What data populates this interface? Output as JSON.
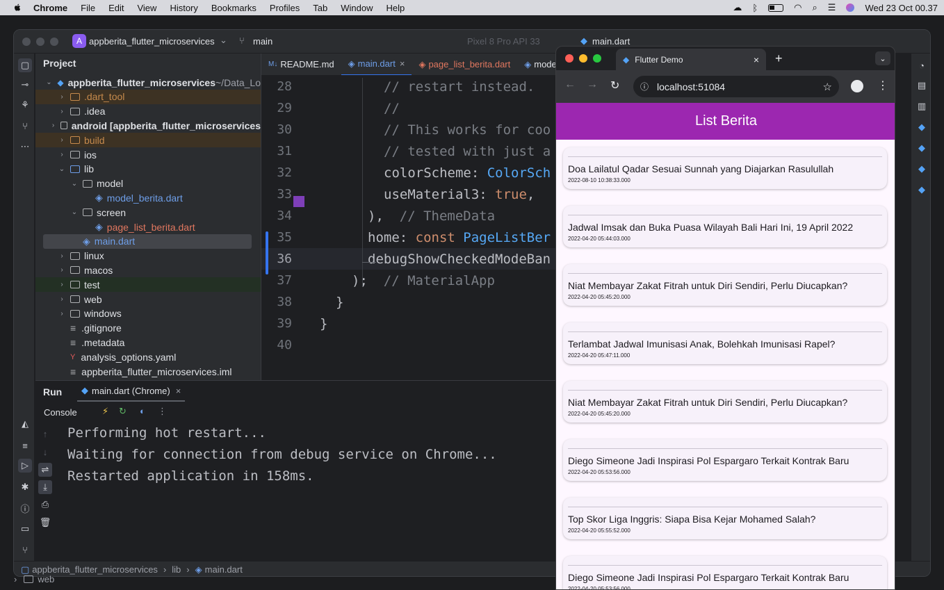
{
  "menubar": {
    "app": "Chrome",
    "items": [
      "File",
      "Edit",
      "View",
      "History",
      "Bookmarks",
      "Profiles",
      "Tab",
      "Window",
      "Help"
    ],
    "datetime": "Wed 23 Oct  00.37"
  },
  "ide": {
    "project_name": "appberita_flutter_microservices",
    "project_badge": "A",
    "branch": "main",
    "device": "Pixel 8 Pro API 33",
    "run_config": "main.dart",
    "target": "Chrome (web)",
    "project_panel_title": "Project",
    "tree": [
      {
        "label": "appberita_flutter_microservices",
        "suffix": "~/Data_Lo",
        "indent": 0,
        "type": "root",
        "chev": "⌄"
      },
      {
        "label": ".dart_tool",
        "indent": 1,
        "type": "folder-orange",
        "chev": "›",
        "color": "#c68a4c",
        "hl": "#3d3223"
      },
      {
        "label": ".idea",
        "indent": 1,
        "type": "folder",
        "chev": "›"
      },
      {
        "label": "android [appberita_flutter_microservices",
        "indent": 1,
        "type": "folder",
        "chev": "›",
        "bold": true
      },
      {
        "label": "build",
        "indent": 1,
        "type": "folder-orange",
        "chev": "›",
        "color": "#c68a4c",
        "hl": "#3d3223"
      },
      {
        "label": "ios",
        "indent": 1,
        "type": "folder",
        "chev": "›"
      },
      {
        "label": "lib",
        "indent": 1,
        "type": "folder-blue",
        "chev": "⌄"
      },
      {
        "label": "model",
        "indent": 2,
        "type": "folder",
        "chev": "⌄"
      },
      {
        "label": "model_berita.dart",
        "indent": 3,
        "type": "dart",
        "color": "#6e9ee8"
      },
      {
        "label": "screen",
        "indent": 2,
        "type": "folder",
        "chev": "⌄"
      },
      {
        "label": "page_list_berita.dart",
        "indent": 3,
        "type": "dart",
        "color": "#e0775f"
      },
      {
        "label": "main.dart",
        "indent": 2,
        "type": "dart",
        "color": "#6e9ee8",
        "hl": "#43454a"
      },
      {
        "label": "linux",
        "indent": 1,
        "type": "folder",
        "chev": "›"
      },
      {
        "label": "macos",
        "indent": 1,
        "type": "folder",
        "chev": "›"
      },
      {
        "label": "test",
        "indent": 1,
        "type": "folder",
        "chev": "›",
        "hl": "#233024"
      },
      {
        "label": "web",
        "indent": 1,
        "type": "folder",
        "chev": "›"
      },
      {
        "label": "windows",
        "indent": 1,
        "type": "folder",
        "chev": "›"
      },
      {
        "label": ".gitignore",
        "indent": 1,
        "type": "file"
      },
      {
        "label": ".metadata",
        "indent": 1,
        "type": "file"
      },
      {
        "label": "analysis_options.yaml",
        "indent": 1,
        "type": "yaml"
      },
      {
        "label": "appberita_flutter_microservices.iml",
        "indent": 1,
        "type": "file"
      }
    ],
    "tabs": [
      {
        "label": "README.md",
        "prefix": "M↓"
      },
      {
        "label": "main.dart",
        "active": true,
        "close": "×"
      },
      {
        "label": "page_list_berita.dart",
        "color": "#e0775f"
      },
      {
        "label": "mode"
      }
    ],
    "code": [
      {
        "n": "28",
        "parts": [
          [
            "cm",
            "// restart instead."
          ]
        ]
      },
      {
        "n": "29",
        "parts": [
          [
            "cm",
            "//"
          ]
        ]
      },
      {
        "n": "30",
        "parts": [
          [
            "cm",
            "// This works for coo"
          ]
        ]
      },
      {
        "n": "31",
        "parts": [
          [
            "cm",
            "// tested with just a"
          ]
        ]
      },
      {
        "n": "32",
        "parts": [
          [
            "",
            "colorScheme: "
          ],
          [
            "cls",
            "ColorSch"
          ]
        ]
      },
      {
        "n": "33",
        "parts": [
          [
            "",
            "useMaterial3: "
          ],
          [
            "kw",
            "true"
          ],
          [
            "",
            ","
          ]
        ]
      },
      {
        "n": "34",
        "parts": [
          [
            "",
            "),  "
          ],
          [
            "cm",
            "// ThemeData"
          ]
        ]
      },
      {
        "n": "35",
        "parts": [
          [
            "",
            "home: "
          ],
          [
            "kw",
            "const "
          ],
          [
            "cls",
            "PageListBer"
          ]
        ]
      },
      {
        "n": "36",
        "parts": [
          [
            "",
            "debugShowCheckedModeBan"
          ]
        ]
      },
      {
        "n": "37",
        "parts": [
          [
            "",
            ");  "
          ],
          [
            "cm",
            "// MaterialApp"
          ]
        ]
      },
      {
        "n": "38",
        "parts": [
          [
            "",
            "}"
          ]
        ]
      },
      {
        "n": "39",
        "parts": [
          [
            "",
            "}"
          ]
        ]
      },
      {
        "n": "40",
        "parts": []
      }
    ],
    "run_tab": "Run",
    "run_config_tab": "main.dart (Chrome)",
    "console_label": "Console",
    "console_lines": [
      "Performing hot restart...",
      "Waiting for connection from debug service on Chrome...",
      "Restarted application in 158ms."
    ],
    "breadcrumb": [
      "appberita_flutter_microservices",
      "lib",
      "main.dart"
    ],
    "bg_tab_hint": "web"
  },
  "browser": {
    "tab_title": "Flutter Demo",
    "url": "localhost:51084",
    "app_title": "List Berita",
    "news": [
      {
        "title": "Doa Lailatul Qadar Sesuai Sunnah yang Diajarkan Rasulullah",
        "date": "2022-08-10 10:38:33.000"
      },
      {
        "title": "Jadwal Imsak dan Buka Puasa Wilayah Bali Hari Ini, 19 April 2022",
        "date": "2022-04-20 05:44:03.000"
      },
      {
        "title": "Niat Membayar Zakat Fitrah untuk Diri Sendiri, Perlu Diucapkan?",
        "date": "2022-04-20 05:45:20.000"
      },
      {
        "title": "Terlambat Jadwal Imunisasi Anak, Bolehkah Imunisasi Rapel?",
        "date": "2022-04-20 05:47:11.000"
      },
      {
        "title": "Niat Membayar Zakat Fitrah untuk Diri Sendiri, Perlu Diucapkan?",
        "date": "2022-04-20 05:45:20.000"
      },
      {
        "title": "Diego Simeone Jadi Inspirasi Pol Espargaro Terkait Kontrak Baru",
        "date": "2022-04-20 05:53:56.000"
      },
      {
        "title": "Top Skor Liga Inggris: Siapa Bisa Kejar Mohamed Salah?",
        "date": "2022-04-20 05:55:52.000"
      },
      {
        "title": "Diego Simeone Jadi Inspirasi Pol Espargaro Terkait Kontrak Baru",
        "date": "2022-04-20 05:53:56.000"
      }
    ]
  },
  "colors": {
    "appbar": "#9c27b0",
    "accent": "#3574f0",
    "run": "#5fb865",
    "stop": "#db5c5c"
  }
}
